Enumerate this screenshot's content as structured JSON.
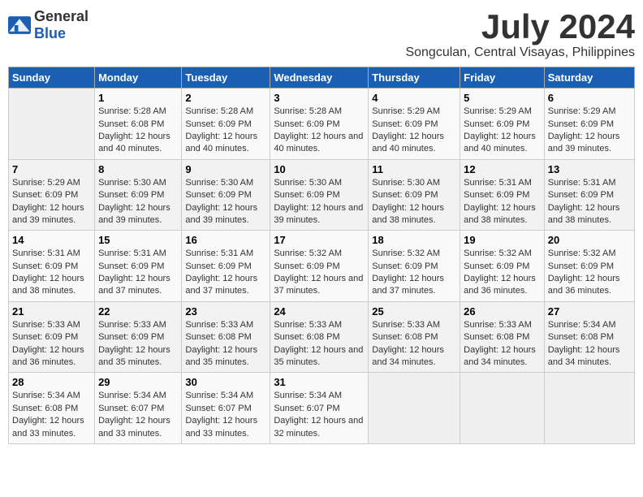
{
  "header": {
    "logo_general": "General",
    "logo_blue": "Blue",
    "month_year": "July 2024",
    "location": "Songculan, Central Visayas, Philippines"
  },
  "days_of_week": [
    "Sunday",
    "Monday",
    "Tuesday",
    "Wednesday",
    "Thursday",
    "Friday",
    "Saturday"
  ],
  "weeks": [
    [
      {
        "day": "",
        "sunrise": "",
        "sunset": "",
        "daylight": ""
      },
      {
        "day": "1",
        "sunrise": "Sunrise: 5:28 AM",
        "sunset": "Sunset: 6:08 PM",
        "daylight": "Daylight: 12 hours and 40 minutes."
      },
      {
        "day": "2",
        "sunrise": "Sunrise: 5:28 AM",
        "sunset": "Sunset: 6:09 PM",
        "daylight": "Daylight: 12 hours and 40 minutes."
      },
      {
        "day": "3",
        "sunrise": "Sunrise: 5:28 AM",
        "sunset": "Sunset: 6:09 PM",
        "daylight": "Daylight: 12 hours and 40 minutes."
      },
      {
        "day": "4",
        "sunrise": "Sunrise: 5:29 AM",
        "sunset": "Sunset: 6:09 PM",
        "daylight": "Daylight: 12 hours and 40 minutes."
      },
      {
        "day": "5",
        "sunrise": "Sunrise: 5:29 AM",
        "sunset": "Sunset: 6:09 PM",
        "daylight": "Daylight: 12 hours and 40 minutes."
      },
      {
        "day": "6",
        "sunrise": "Sunrise: 5:29 AM",
        "sunset": "Sunset: 6:09 PM",
        "daylight": "Daylight: 12 hours and 39 minutes."
      }
    ],
    [
      {
        "day": "7",
        "sunrise": "Sunrise: 5:29 AM",
        "sunset": "Sunset: 6:09 PM",
        "daylight": "Daylight: 12 hours and 39 minutes."
      },
      {
        "day": "8",
        "sunrise": "Sunrise: 5:30 AM",
        "sunset": "Sunset: 6:09 PM",
        "daylight": "Daylight: 12 hours and 39 minutes."
      },
      {
        "day": "9",
        "sunrise": "Sunrise: 5:30 AM",
        "sunset": "Sunset: 6:09 PM",
        "daylight": "Daylight: 12 hours and 39 minutes."
      },
      {
        "day": "10",
        "sunrise": "Sunrise: 5:30 AM",
        "sunset": "Sunset: 6:09 PM",
        "daylight": "Daylight: 12 hours and 39 minutes."
      },
      {
        "day": "11",
        "sunrise": "Sunrise: 5:30 AM",
        "sunset": "Sunset: 6:09 PM",
        "daylight": "Daylight: 12 hours and 38 minutes."
      },
      {
        "day": "12",
        "sunrise": "Sunrise: 5:31 AM",
        "sunset": "Sunset: 6:09 PM",
        "daylight": "Daylight: 12 hours and 38 minutes."
      },
      {
        "day": "13",
        "sunrise": "Sunrise: 5:31 AM",
        "sunset": "Sunset: 6:09 PM",
        "daylight": "Daylight: 12 hours and 38 minutes."
      }
    ],
    [
      {
        "day": "14",
        "sunrise": "Sunrise: 5:31 AM",
        "sunset": "Sunset: 6:09 PM",
        "daylight": "Daylight: 12 hours and 38 minutes."
      },
      {
        "day": "15",
        "sunrise": "Sunrise: 5:31 AM",
        "sunset": "Sunset: 6:09 PM",
        "daylight": "Daylight: 12 hours and 37 minutes."
      },
      {
        "day": "16",
        "sunrise": "Sunrise: 5:31 AM",
        "sunset": "Sunset: 6:09 PM",
        "daylight": "Daylight: 12 hours and 37 minutes."
      },
      {
        "day": "17",
        "sunrise": "Sunrise: 5:32 AM",
        "sunset": "Sunset: 6:09 PM",
        "daylight": "Daylight: 12 hours and 37 minutes."
      },
      {
        "day": "18",
        "sunrise": "Sunrise: 5:32 AM",
        "sunset": "Sunset: 6:09 PM",
        "daylight": "Daylight: 12 hours and 37 minutes."
      },
      {
        "day": "19",
        "sunrise": "Sunrise: 5:32 AM",
        "sunset": "Sunset: 6:09 PM",
        "daylight": "Daylight: 12 hours and 36 minutes."
      },
      {
        "day": "20",
        "sunrise": "Sunrise: 5:32 AM",
        "sunset": "Sunset: 6:09 PM",
        "daylight": "Daylight: 12 hours and 36 minutes."
      }
    ],
    [
      {
        "day": "21",
        "sunrise": "Sunrise: 5:33 AM",
        "sunset": "Sunset: 6:09 PM",
        "daylight": "Daylight: 12 hours and 36 minutes."
      },
      {
        "day": "22",
        "sunrise": "Sunrise: 5:33 AM",
        "sunset": "Sunset: 6:09 PM",
        "daylight": "Daylight: 12 hours and 35 minutes."
      },
      {
        "day": "23",
        "sunrise": "Sunrise: 5:33 AM",
        "sunset": "Sunset: 6:08 PM",
        "daylight": "Daylight: 12 hours and 35 minutes."
      },
      {
        "day": "24",
        "sunrise": "Sunrise: 5:33 AM",
        "sunset": "Sunset: 6:08 PM",
        "daylight": "Daylight: 12 hours and 35 minutes."
      },
      {
        "day": "25",
        "sunrise": "Sunrise: 5:33 AM",
        "sunset": "Sunset: 6:08 PM",
        "daylight": "Daylight: 12 hours and 34 minutes."
      },
      {
        "day": "26",
        "sunrise": "Sunrise: 5:33 AM",
        "sunset": "Sunset: 6:08 PM",
        "daylight": "Daylight: 12 hours and 34 minutes."
      },
      {
        "day": "27",
        "sunrise": "Sunrise: 5:34 AM",
        "sunset": "Sunset: 6:08 PM",
        "daylight": "Daylight: 12 hours and 34 minutes."
      }
    ],
    [
      {
        "day": "28",
        "sunrise": "Sunrise: 5:34 AM",
        "sunset": "Sunset: 6:08 PM",
        "daylight": "Daylight: 12 hours and 33 minutes."
      },
      {
        "day": "29",
        "sunrise": "Sunrise: 5:34 AM",
        "sunset": "Sunset: 6:07 PM",
        "daylight": "Daylight: 12 hours and 33 minutes."
      },
      {
        "day": "30",
        "sunrise": "Sunrise: 5:34 AM",
        "sunset": "Sunset: 6:07 PM",
        "daylight": "Daylight: 12 hours and 33 minutes."
      },
      {
        "day": "31",
        "sunrise": "Sunrise: 5:34 AM",
        "sunset": "Sunset: 6:07 PM",
        "daylight": "Daylight: 12 hours and 32 minutes."
      },
      {
        "day": "",
        "sunrise": "",
        "sunset": "",
        "daylight": ""
      },
      {
        "day": "",
        "sunrise": "",
        "sunset": "",
        "daylight": ""
      },
      {
        "day": "",
        "sunrise": "",
        "sunset": "",
        "daylight": ""
      }
    ]
  ]
}
